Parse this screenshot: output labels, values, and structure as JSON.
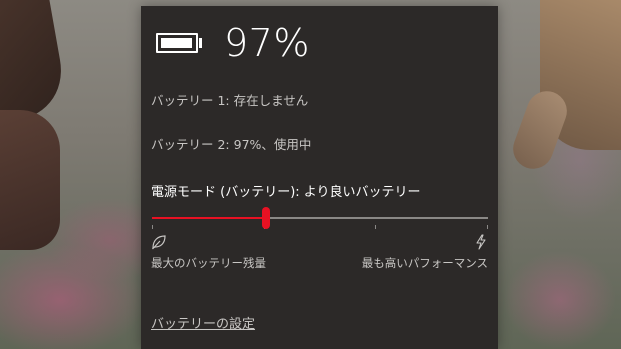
{
  "battery": {
    "percent_text": "97%",
    "charge_fraction": 0.97,
    "icon": "battery-icon"
  },
  "status": {
    "battery1": "バッテリー 1: 存在しません",
    "battery2": "バッテリー 2: 97%、使用中"
  },
  "power_mode": {
    "title": "電源モード (バッテリー): より良いバッテリー",
    "slider_position": 0.34,
    "left_label": "最大のバッテリー残量",
    "right_label": "最も高いパフォーマンス",
    "left_icon": "leaf-icon",
    "right_icon": "lightning-icon",
    "accent_color": "#e81123"
  },
  "settings_link": "バッテリーの設定"
}
